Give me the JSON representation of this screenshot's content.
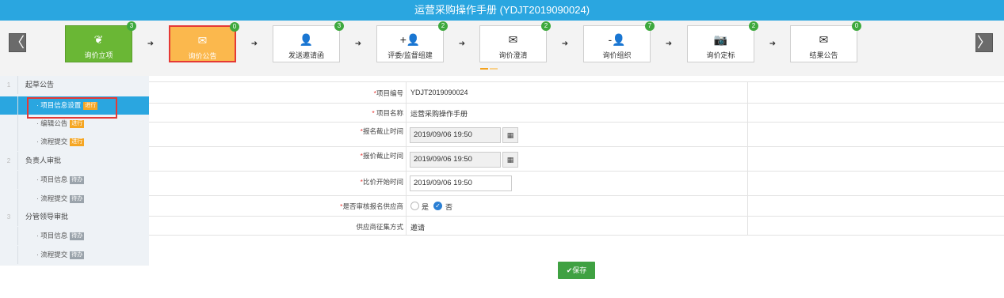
{
  "title": "运营采购操作手册 (YDJT2019090024)",
  "nav": {
    "prev_icon": "chevron-left-icon",
    "prev_glyph": "〈",
    "next_icon": "chevron-right-icon",
    "next_glyph": "〉"
  },
  "steps": [
    {
      "label": "询价立项",
      "badge": "3",
      "icon": "leaf-icon",
      "glyph": "❦"
    },
    {
      "label": "询价公告",
      "badge": "0",
      "icon": "envelope-icon",
      "glyph": "✉"
    },
    {
      "label": "发送邀请函",
      "badge": "3",
      "icon": "user-icon",
      "glyph": "👤"
    },
    {
      "label": "评委/监督组建",
      "badge": "2",
      "icon": "user-add-icon",
      "glyph": "+👤"
    },
    {
      "label": "询价澄清",
      "badge": "2",
      "icon": "envelope-icon",
      "glyph": "✉"
    },
    {
      "label": "询价组织",
      "badge": "7",
      "icon": "user-remove-icon",
      "glyph": "-👤"
    },
    {
      "label": "询价定标",
      "badge": "2",
      "icon": "camera-icon",
      "glyph": "📷"
    },
    {
      "label": "结果公告",
      "badge": "0",
      "icon": "envelope-icon",
      "glyph": "✉"
    }
  ],
  "arrow_glyph": "➜",
  "sidebar": {
    "sections": [
      {
        "num": "1",
        "label": "起草公告"
      },
      {
        "num": "2",
        "label": "负责人审批"
      },
      {
        "num": "3",
        "label": "分管领导审批"
      }
    ],
    "items": [
      {
        "label": "· 项目信息设置",
        "tag": "进行"
      },
      {
        "label": "· 编辑公告",
        "tag": "进行"
      },
      {
        "label": "· 流程提交",
        "tag": "进行"
      },
      {
        "label": "· 项目信息",
        "tag": "待办"
      },
      {
        "label": "· 流程提交",
        "tag": "待办"
      },
      {
        "label": "· 项目信息",
        "tag": "待办"
      },
      {
        "label": "· 流程提交",
        "tag": "待办"
      }
    ]
  },
  "form": {
    "project_no": {
      "star": "*",
      "label": "项目编号",
      "value": "YDJT2019090024"
    },
    "project_name": {
      "star": "*",
      "label": " 项目名称",
      "value": "运营采购操作手册"
    },
    "signup_deadline": {
      "star": "*",
      "label": "报名截止时间",
      "value": "2019/09/06 19:50"
    },
    "quote_deadline": {
      "star": "*",
      "label": "报价截止时间",
      "value": "2019/09/06 19:50"
    },
    "compare_start": {
      "star": "*",
      "label": "比价开始时间",
      "value": "2019/09/06 19:50"
    },
    "review_suppliers": {
      "star": "*",
      "label": "是否审核报名供应商",
      "yes": "是",
      "no": "否",
      "selected": "否"
    },
    "collection_method": {
      "label": "供应商征集方式",
      "value": "邀请"
    }
  },
  "calendar_glyph": "▦",
  "check_glyph": "✓",
  "save_label": "✔保存"
}
